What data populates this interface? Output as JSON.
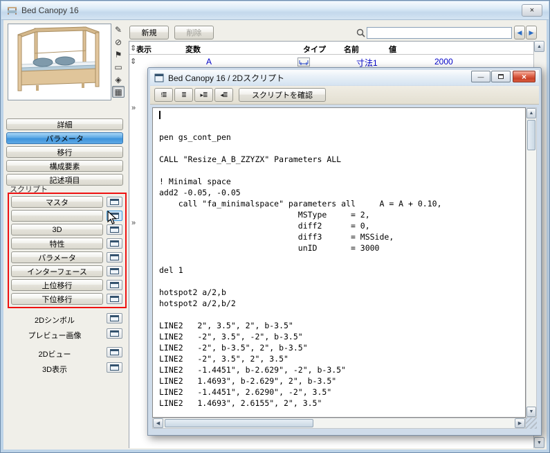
{
  "window": {
    "title": "Bed Canopy 16"
  },
  "toolbar": {
    "new_label": "新規",
    "delete_label": "削除"
  },
  "search": {
    "value": ""
  },
  "param_table": {
    "headers": [
      "表示",
      "変数",
      "タイプ",
      "名前",
      "値"
    ],
    "row": {
      "variable": "A",
      "name": "寸法1",
      "value": "2000"
    }
  },
  "sidebar": {
    "nav_buttons": [
      "詳細",
      "パラメータ",
      "移行",
      "構成要素",
      "記述項目"
    ],
    "script_section_label": "スクリプト",
    "script_buttons": [
      "マスタ",
      "",
      "3D",
      "特性",
      "パラメータ",
      "インターフェース",
      "上位移行",
      "下位移行"
    ],
    "view_items": [
      "2Dシンボル",
      "プレビュー画像",
      "2Dビュー",
      "3D表示"
    ]
  },
  "script_window": {
    "title": "Bed Canopy 16 / 2Dスクリプト",
    "check_script_label": "スクリプトを確認",
    "minimize_glyph": "—",
    "close_glyph": "×",
    "code": "\n\npen gs_cont_pen\n\nCALL \"Resize_A_B_ZZYZX\" Parameters ALL\n\n! Minimal space\nadd2 -0.05, -0.05\n    call \"fa_minimalspace\" parameters all     A = A + 0.10,\n                             MSType     = 2,\n                             diff2      = 0,\n                             diff3      = MSSide,\n                             unID       = 3000\n\ndel 1\n\nhotspot2 a/2,b\nhotspot2 a/2,b/2\n\nLINE2   2\", 3.5\", 2\", b-3.5\"\nLINE2   -2\", 3.5\", -2\", b-3.5\"\nLINE2   -2\", b-3.5\", 2\", b-3.5\"\nLINE2   -2\", 3.5\", 2\", 3.5\"\nLINE2   -1.4451\", b-2.629\", -2\", b-3.5\"\nLINE2   1.4693\", b-2.629\", 2\", b-3.5\"\nLINE2   -1.4451\", 2.6290\", -2\", 3.5\"\nLINE2   1.4693\", 2.6155\", 2\", 3.5\""
  },
  "icons": {
    "pencil": "✎",
    "circle_slash": "⊘",
    "flag": "⚑",
    "page": "▭",
    "cube": "◈",
    "grid": "▦",
    "warning_list": "!≣",
    "list": "≣",
    "next_marker": "▸≣",
    "prev_marker": "◂≣",
    "sort_arrows": "⇕",
    "chevrons": "»",
    "arrow_up": "▲",
    "arrow_down": "▼",
    "arrow_left": "◀",
    "arrow_right": "▶",
    "close": "×",
    "minimize": "—"
  },
  "colors": {
    "active_nav": "#4a9be0",
    "highlight_red": "#ee1111",
    "value_blue": "#0000c8",
    "close_red": "#c94228"
  }
}
